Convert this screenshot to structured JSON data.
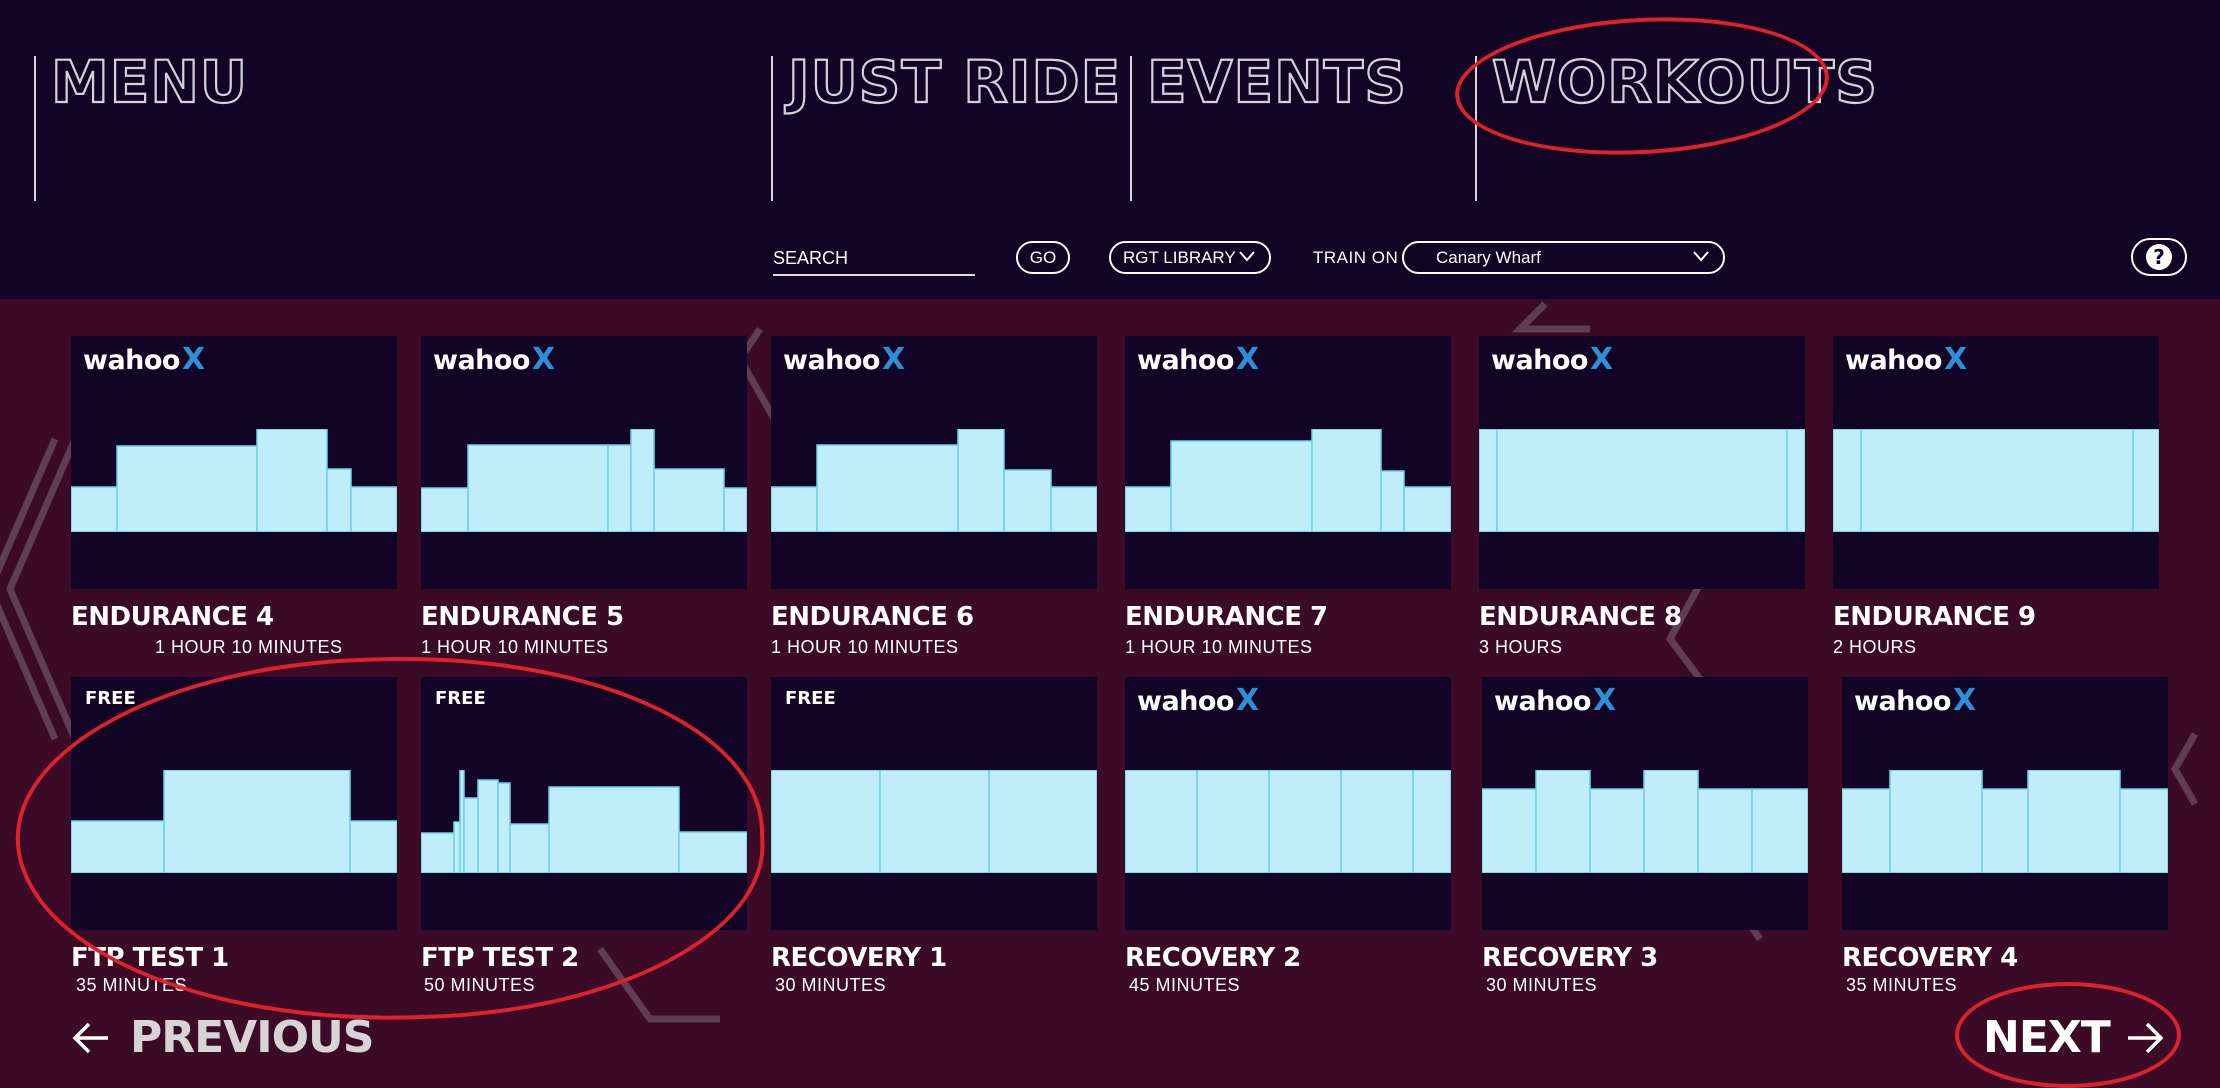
{
  "nav": {
    "menu": "MENU",
    "just_ride": "JUST RIDE",
    "events": "EVENTS",
    "workouts": "WORKOUTS"
  },
  "toolbar": {
    "search_placeholder": "SEARCH",
    "go_label": "GO",
    "library_value": "RGT LIBRARY",
    "train_on_label": "TRAIN ON",
    "train_on_value": "Canary Wharf",
    "help_label": "?"
  },
  "brand": {
    "wahoo": "wahoo",
    "x": "X"
  },
  "free_badge": "FREE",
  "workouts": [
    {
      "title": "ENDURANCE 4",
      "duration": "1 HOUR 10 MINUTES",
      "badge": "wahoo"
    },
    {
      "title": "ENDURANCE 5",
      "duration": "1 HOUR 10 MINUTES",
      "badge": "wahoo"
    },
    {
      "title": "ENDURANCE 6",
      "duration": "1 HOUR 10 MINUTES",
      "badge": "wahoo"
    },
    {
      "title": "ENDURANCE 7",
      "duration": "1 HOUR 10 MINUTES",
      "badge": "wahoo"
    },
    {
      "title": "ENDURANCE 8",
      "duration": "3 HOURS",
      "badge": "wahoo"
    },
    {
      "title": "ENDURANCE 9",
      "duration": "2 HOURS",
      "badge": "wahoo"
    },
    {
      "title": "FTP TEST 1",
      "duration": "35 MINUTES",
      "badge": "free"
    },
    {
      "title": "FTP TEST 2",
      "duration": "50 MINUTES",
      "badge": "free"
    },
    {
      "title": "RECOVERY 1",
      "duration": "30 MINUTES",
      "badge": "free"
    },
    {
      "title": "RECOVERY 2",
      "duration": "45 MINUTES",
      "badge": "wahoo"
    },
    {
      "title": "RECOVERY 3",
      "duration": "30 MINUTES",
      "badge": "wahoo"
    },
    {
      "title": "RECOVERY 4",
      "duration": "35 MINUTES",
      "badge": "wahoo"
    }
  ],
  "pagination": {
    "previous": "PREVIOUS",
    "next": "NEXT"
  },
  "colors": {
    "top_bar_bg": "#110424",
    "page_bg": "#3a0a26",
    "card_bg": "#110424",
    "profile_fill": "#bfeefa",
    "profile_divider": "#6fd0e6",
    "annotation_red": "#e0202a",
    "wahoo_x_blue": "#2f8fd6"
  }
}
